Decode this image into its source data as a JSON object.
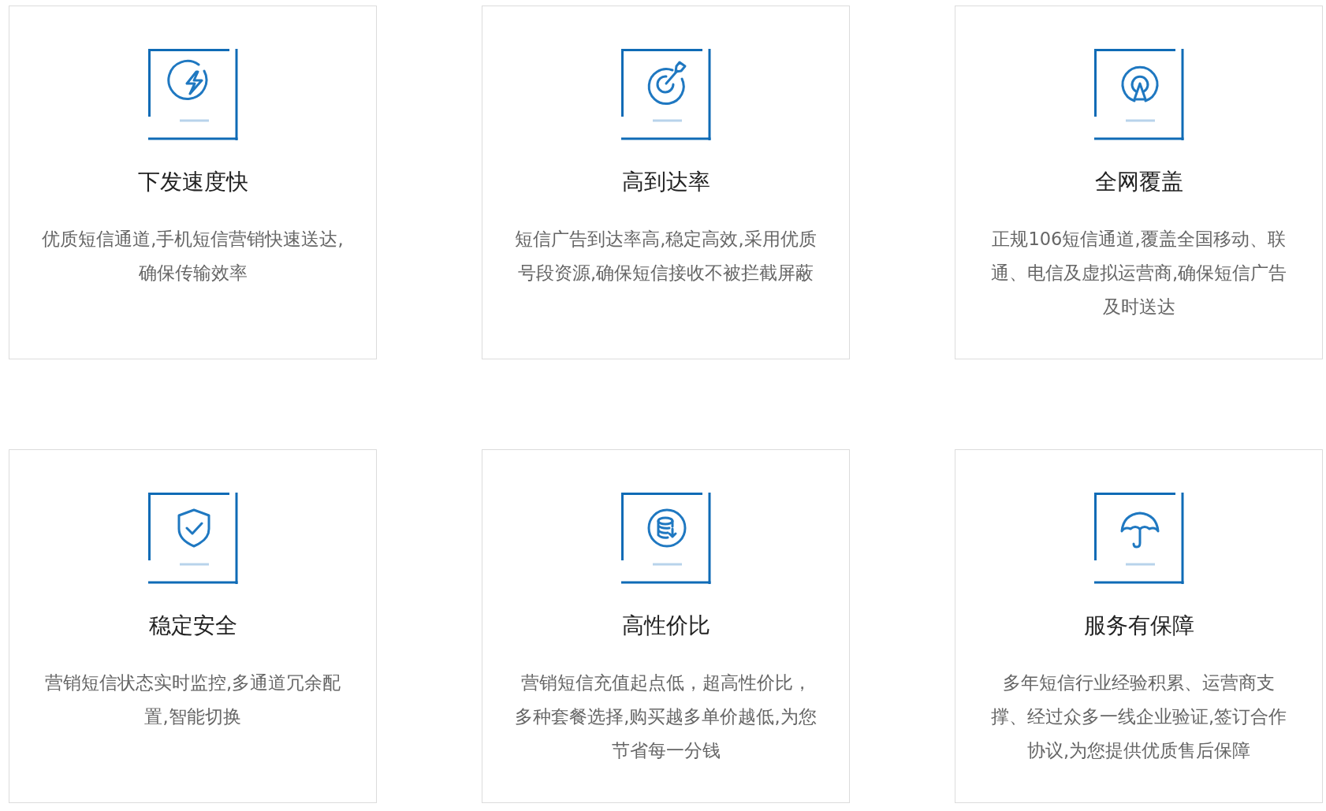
{
  "features": [
    {
      "kind": "lightning",
      "title": "下发速度快",
      "description_lines": [
        "优质短信通道,手机短信营销快速送达,",
        "确保传输效率"
      ]
    },
    {
      "kind": "target",
      "title": "高到达率",
      "description_lines": [
        "短信广告到达率高,稳定高效,采用优质",
        "号段资源,确保短信接收不被拦截屏蔽"
      ]
    },
    {
      "kind": "signal",
      "title": "全网覆盖",
      "description_lines": [
        "正规106短信通道,覆盖全国移动、联",
        "通、电信及虚拟运营商,确保短信广告",
        "及时送达"
      ]
    },
    {
      "kind": "shield",
      "title": "稳定安全",
      "description_lines": [
        "营销短信状态实时监控,多通道冗余配",
        "置,智能切换"
      ]
    },
    {
      "kind": "database",
      "title": "高性价比",
      "description_lines": [
        "营销短信充值起点低，超高性价比，",
        "多种套餐选择,购买越多单价越低,为您",
        "节省每一分钱"
      ]
    },
    {
      "kind": "umbrella",
      "title": "服务有保障",
      "description_lines": [
        "多年短信行业经验积累、运营商支",
        "撑、经过众多一线企业验证,签订合作",
        "协议,为您提供优质售后保障"
      ]
    }
  ]
}
